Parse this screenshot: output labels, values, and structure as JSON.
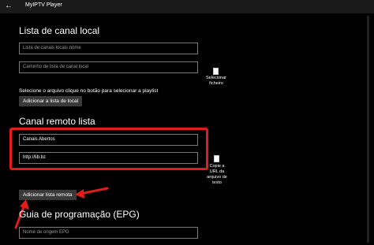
{
  "window": {
    "title": "MyIPTV Player"
  },
  "local": {
    "heading": "Lista de canal local",
    "name_placeholder": "Lista de canais locais nome",
    "path_placeholder": "Caminho de lista de canal local",
    "select_file_label": "Selecionar ficheiro",
    "instruction": "Selecione o arquivo clique no botão para selecionar a playlist",
    "add_button": "Adicionar a lista de local"
  },
  "remote": {
    "heading": "Canal remoto lista",
    "name_value": "Canais Abertos",
    "url_value": "http://lib.bz",
    "copy_caption_1": "Copie a",
    "copy_caption_2": "URL da",
    "copy_caption_3": "arquivo de",
    "copy_caption_4": "texto",
    "add_button": "Adicionar lista remota"
  },
  "epg": {
    "heading": "Guia de programação (EPG)",
    "source_placeholder": "Nome de origem EPG"
  },
  "colors": {
    "highlight": "#e31b1b",
    "background": "#000000",
    "button": "#3a3a3a"
  }
}
